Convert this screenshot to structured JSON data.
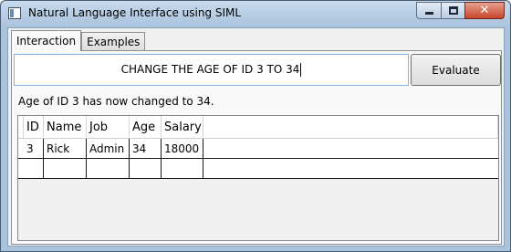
{
  "window": {
    "title": "Natural Language Interface using SIML",
    "controls": {
      "minimize": "minimize-icon",
      "maximize": "maximize-icon",
      "close": "close-icon"
    }
  },
  "tabs": [
    {
      "label": "Interaction",
      "active": true
    },
    {
      "label": "Examples",
      "active": false
    }
  ],
  "query": {
    "value": "CHANGE THE AGE OF ID 3 TO 34"
  },
  "evaluate_label": "Evaluate",
  "result_text": "Age of ID 3 has now changed to 34.",
  "grid": {
    "columns": [
      "ID",
      "Name",
      "Job",
      "Age",
      "Salary"
    ],
    "rows": [
      [
        "3",
        "Rick",
        "Admin",
        "34",
        "18000"
      ],
      [
        "",
        "",
        "",
        "",
        ""
      ]
    ]
  },
  "colors": {
    "title_bar": "#a9c2dc",
    "close_button": "#c7452b",
    "input_border": "#7eb4ea"
  }
}
